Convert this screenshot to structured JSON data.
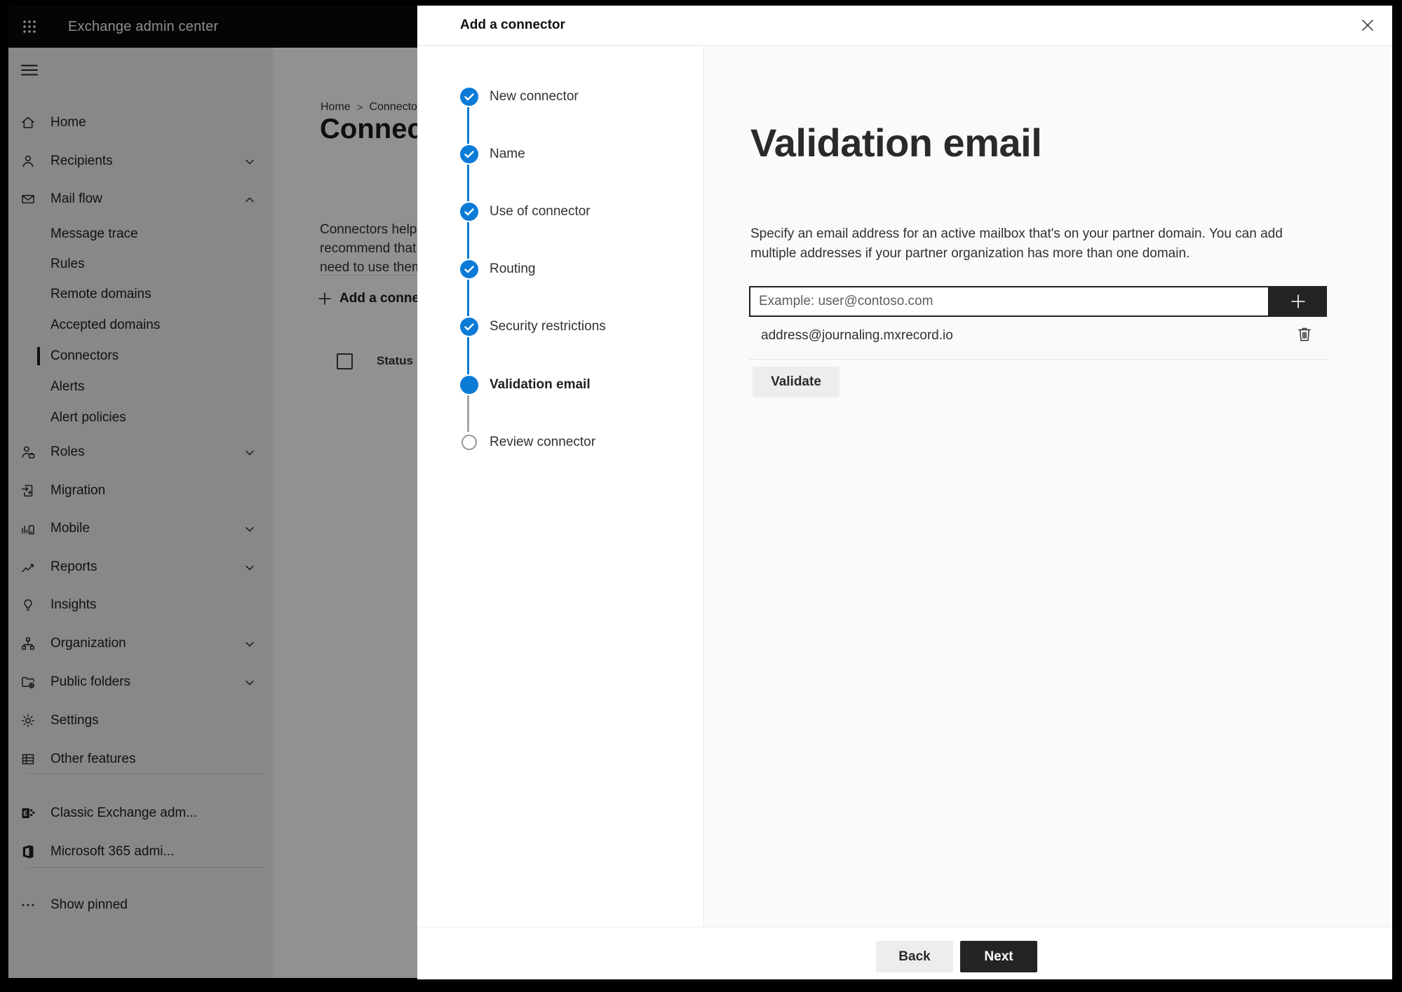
{
  "topbar": {
    "title": "Exchange admin center"
  },
  "breadcrumb": {
    "items": [
      "Home",
      "Connectors"
    ],
    "separator": ">"
  },
  "page": {
    "title": "Connectors",
    "description_lines": [
      "Connectors help control the flow of email",
      "recommend that you check to see if you",
      "need to use them."
    ],
    "add_button_label": "Add a connector",
    "table": {
      "columns": [
        "Status"
      ]
    }
  },
  "sidebar": {
    "items": [
      {
        "label": "Home",
        "icon": "home-icon"
      },
      {
        "label": "Recipients",
        "icon": "person-icon",
        "chevron": "down"
      },
      {
        "label": "Mail flow",
        "icon": "mail-icon",
        "chevron": "up",
        "expanded": true
      },
      {
        "label": "Message trace",
        "child": true
      },
      {
        "label": "Rules",
        "child": true
      },
      {
        "label": "Remote domains",
        "child": true
      },
      {
        "label": "Accepted domains",
        "child": true
      },
      {
        "label": "Connectors",
        "child": true,
        "selected": true
      },
      {
        "label": "Alerts",
        "child": true
      },
      {
        "label": "Alert policies",
        "child": true
      },
      {
        "label": "Roles",
        "icon": "roles-icon",
        "chevron": "down"
      },
      {
        "label": "Migration",
        "icon": "migration-icon"
      },
      {
        "label": "Mobile",
        "icon": "mobile-icon",
        "chevron": "down"
      },
      {
        "label": "Reports",
        "icon": "reports-icon",
        "chevron": "down"
      },
      {
        "label": "Insights",
        "icon": "lightbulb-icon"
      },
      {
        "label": "Organization",
        "icon": "org-tree-icon",
        "chevron": "down"
      },
      {
        "label": "Public folders",
        "icon": "folder-globe-icon",
        "chevron": "down"
      },
      {
        "label": "Settings",
        "icon": "gear-icon"
      },
      {
        "label": "Other features",
        "icon": "table-grid-icon"
      },
      {
        "label": "Classic Exchange adm...",
        "icon": "exchange-logo-icon"
      },
      {
        "label": "Microsoft 365 admi...",
        "icon": "microsoft-365-icon"
      },
      {
        "label": "Show pinned",
        "icon": "more-dots-icon"
      }
    ]
  },
  "dialog": {
    "title": "Add a connector",
    "steps": [
      {
        "label": "New connector",
        "state": "completed"
      },
      {
        "label": "Name",
        "state": "completed"
      },
      {
        "label": "Use of connector",
        "state": "completed"
      },
      {
        "label": "Routing",
        "state": "completed"
      },
      {
        "label": "Security restrictions",
        "state": "completed"
      },
      {
        "label": "Validation email",
        "state": "current"
      },
      {
        "label": "Review connector",
        "state": "upcoming"
      }
    ],
    "content": {
      "heading": "Validation email",
      "description_lines": [
        "Specify an email address for an active mailbox that's on your partner domain. You can add",
        "multiple addresses if your partner organization has more than one domain."
      ],
      "email_input": {
        "value": "",
        "placeholder": "Example: user@contoso.com"
      },
      "addresses": [
        "address@journaling.mxrecord.io"
      ],
      "validate_button_label": "Validate"
    },
    "footer": {
      "back_label": "Back",
      "next_label": "Next"
    }
  },
  "colors": {
    "accent_blue": "#0b7bd7",
    "dark_button": "#252423",
    "topbar": "#0a0a0a"
  }
}
